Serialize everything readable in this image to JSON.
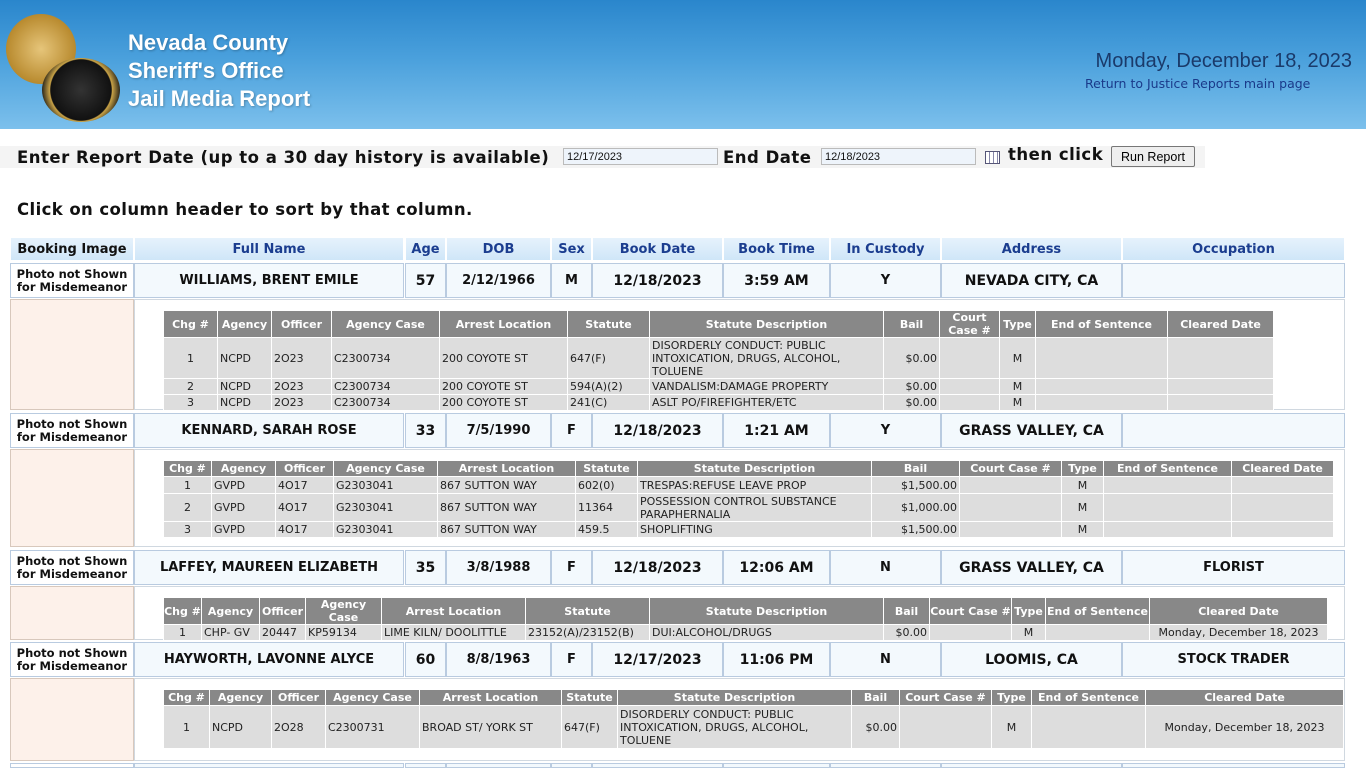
{
  "header": {
    "line1": "Nevada County",
    "line2": "Sheriff's Office",
    "line3": "Jail Media Report",
    "date": "Monday, December 18, 2023",
    "return_link": "Return to Justice Reports main page",
    "badge_top": "SHERIFF",
    "badge_side": "NEVADA",
    "badge_bottom": "NEVADA COUNTY",
    "badge_sub": "SHERIFF"
  },
  "form": {
    "report_label": "Enter Report Date (up to a 30 day history is available)",
    "start_date": "12/17/2023",
    "end_label": "End Date",
    "end_date": "12/18/2023",
    "then_click": "then click",
    "run_button": "Run Report"
  },
  "sort_hint": "Click on column header to sort by that column.",
  "columns": [
    "Booking Image",
    "Full Name",
    "Age",
    "DOB",
    "Sex",
    "Book Date",
    "Book Time",
    "In Custody",
    "Address",
    "Occupation"
  ],
  "charge_columns": [
    "Chg #",
    "Agency",
    "Officer",
    "Agency Case",
    "Arrest Location",
    "Statute",
    "Statute Description",
    "Bail",
    "Court Case #",
    "Type",
    "End of Sentence",
    "Cleared Date"
  ],
  "inmates": [
    {
      "photo": "Photo not Shown for Misdemeanor",
      "name": "WILLIAMS, BRENT EMILE",
      "age": "57",
      "dob": "2/12/1966",
      "sex": "M",
      "book_date": "12/18/2023",
      "book_time": "3:59 AM",
      "in_custody": "Y",
      "address": "NEVADA CITY, CA",
      "occupation": "",
      "charges": [
        {
          "chg": "1",
          "agency": "NCPD",
          "officer": "2O23",
          "case": "C2300734",
          "location": "200 COYOTE ST",
          "statute": "647(F)",
          "desc": "DISORDERLY CONDUCT: PUBLIC INTOXICATION, DRUGS, ALCOHOL, TOLUENE",
          "bail": "$0.00",
          "court": "",
          "type": "M",
          "end": "",
          "cleared": ""
        },
        {
          "chg": "2",
          "agency": "NCPD",
          "officer": "2O23",
          "case": "C2300734",
          "location": "200 COYOTE ST",
          "statute": "594(A)(2)",
          "desc": "VANDALISM:DAMAGE PROPERTY",
          "bail": "$0.00",
          "court": "",
          "type": "M",
          "end": "",
          "cleared": ""
        },
        {
          "chg": "3",
          "agency": "NCPD",
          "officer": "2O23",
          "case": "C2300734",
          "location": "200 COYOTE ST",
          "statute": "241(C)",
          "desc": "ASLT PO/FIREFIGHTER/ETC",
          "bail": "$0.00",
          "court": "",
          "type": "M",
          "end": "",
          "cleared": ""
        }
      ]
    },
    {
      "photo": "Photo not Shown for Misdemeanor",
      "name": "KENNARD, SARAH ROSE",
      "age": "33",
      "dob": "7/5/1990",
      "sex": "F",
      "book_date": "12/18/2023",
      "book_time": "1:21 AM",
      "in_custody": "Y",
      "address": "GRASS VALLEY, CA",
      "occupation": "",
      "charges": [
        {
          "chg": "1",
          "agency": "GVPD",
          "officer": "4O17",
          "case": "G2303041",
          "location": "867 SUTTON WAY",
          "statute": "602(0)",
          "desc": "TRESPAS:REFUSE LEAVE PROP",
          "bail": "$1,500.00",
          "court": "",
          "type": "M",
          "end": "",
          "cleared": ""
        },
        {
          "chg": "2",
          "agency": "GVPD",
          "officer": "4O17",
          "case": "G2303041",
          "location": "867 SUTTON WAY",
          "statute": "11364",
          "desc": "POSSESSION CONTROL SUBSTANCE PARAPHERNALIA",
          "bail": "$1,000.00",
          "court": "",
          "type": "M",
          "end": "",
          "cleared": ""
        },
        {
          "chg": "3",
          "agency": "GVPD",
          "officer": "4O17",
          "case": "G2303041",
          "location": "867 SUTTON WAY",
          "statute": "459.5",
          "desc": "SHOPLIFTING",
          "bail": "$1,500.00",
          "court": "",
          "type": "M",
          "end": "",
          "cleared": ""
        }
      ]
    },
    {
      "photo": "Photo not Shown for Misdemeanor",
      "name": "LAFFEY, MAUREEN ELIZABETH",
      "age": "35",
      "dob": "3/8/1988",
      "sex": "F",
      "book_date": "12/18/2023",
      "book_time": "12:06 AM",
      "in_custody": "N",
      "address": "GRASS VALLEY, CA",
      "occupation": "FLORIST",
      "charges": [
        {
          "chg": "1",
          "agency": "CHP- GV",
          "officer": "20447",
          "case": "KP59134",
          "location": "LIME KILN/ DOOLITTLE",
          "statute": "23152(A)/23152(B)",
          "desc": "DUI:ALCOHOL/DRUGS",
          "bail": "$0.00",
          "court": "",
          "type": "M",
          "end": "",
          "cleared": "Monday, December 18, 2023"
        }
      ]
    },
    {
      "photo": "Photo not Shown for Misdemeanor",
      "name": "HAYWORTH, LAVONNE ALYCE",
      "age": "60",
      "dob": "8/8/1963",
      "sex": "F",
      "book_date": "12/17/2023",
      "book_time": "11:06 PM",
      "in_custody": "N",
      "address": "LOOMIS, CA",
      "occupation": "STOCK TRADER",
      "charges": [
        {
          "chg": "1",
          "agency": "NCPD",
          "officer": "2O28",
          "case": "C2300731",
          "location": "BROAD ST/ YORK ST",
          "statute": "647(F)",
          "desc": "DISORDERLY CONDUCT: PUBLIC INTOXICATION, DRUGS, ALCOHOL, TOLUENE",
          "bail": "$0.00",
          "court": "",
          "type": "M",
          "end": "",
          "cleared": "Monday, December 18, 2023"
        }
      ]
    }
  ]
}
